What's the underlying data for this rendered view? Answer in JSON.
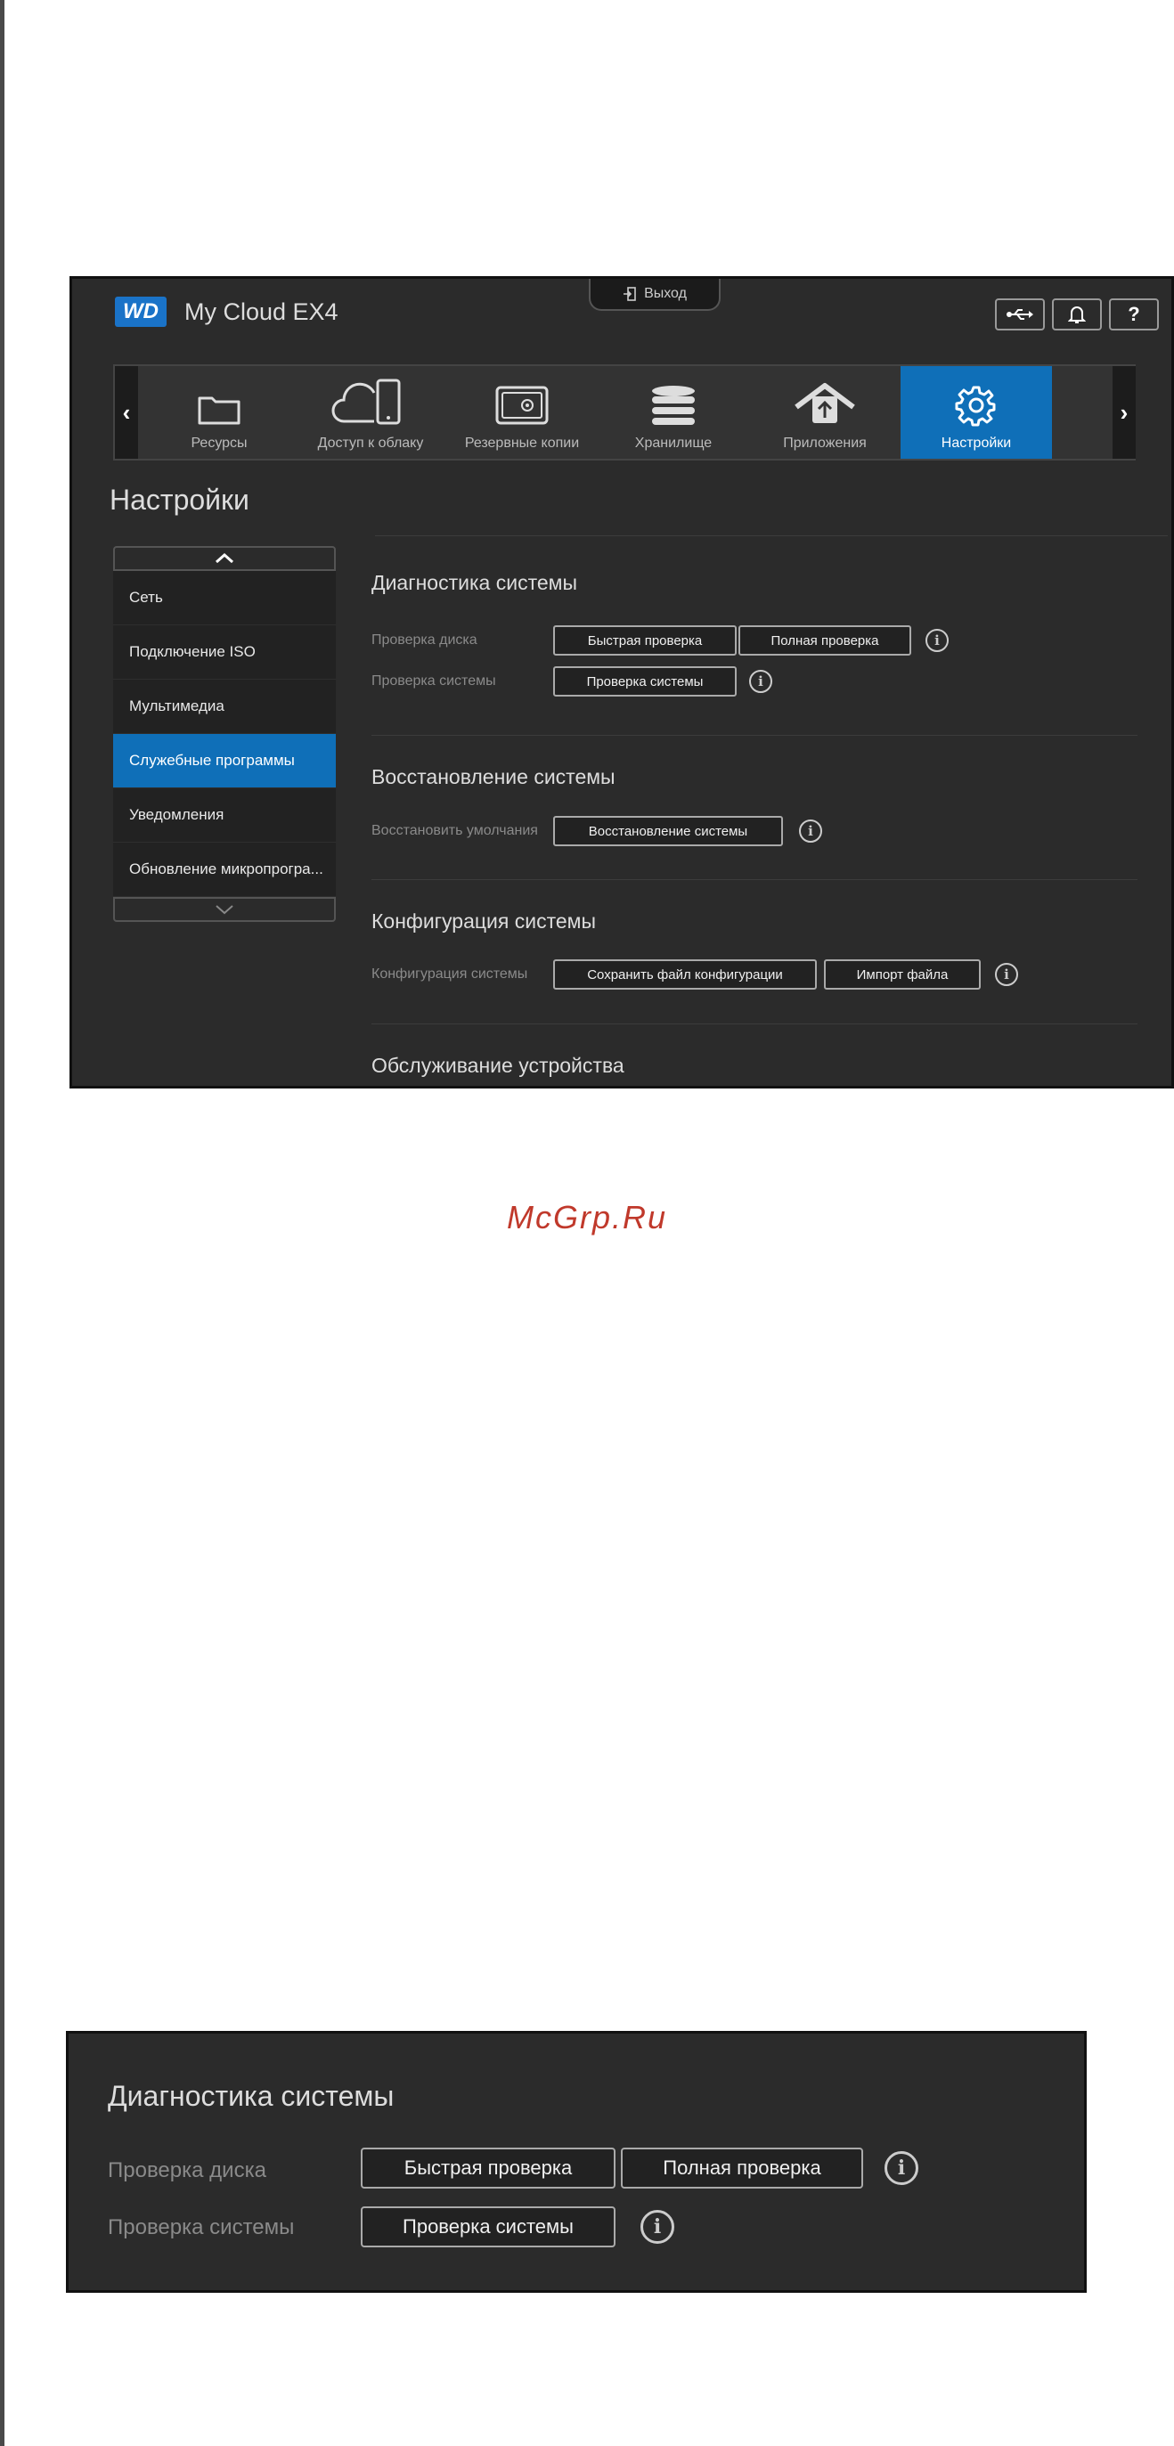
{
  "app": {
    "brand": "WD",
    "product": "My Cloud EX4",
    "logout_label": "Выход",
    "usb_icon": "usb-icon",
    "bell_icon": "bell-icon",
    "help_label": "?"
  },
  "nav": {
    "prev": "‹",
    "next": "›",
    "items": [
      {
        "label": "Ресурсы",
        "icon": "folder-icon"
      },
      {
        "label": "Доступ к облаку",
        "icon": "cloud-device-icon"
      },
      {
        "label": "Резервные копии",
        "icon": "safe-icon"
      },
      {
        "label": "Хранилище",
        "icon": "database-icon"
      },
      {
        "label": "Приложения",
        "icon": "apps-icon"
      },
      {
        "label": "Настройки",
        "icon": "gear-icon",
        "active": true
      }
    ]
  },
  "page": {
    "title": "Настройки"
  },
  "sidebar": {
    "up": "⌃",
    "down": "⌄",
    "items": [
      {
        "label": "Сеть"
      },
      {
        "label": "Подключение ISO"
      },
      {
        "label": "Мультимедиа"
      },
      {
        "label": "Служебные программы",
        "active": true
      },
      {
        "label": "Уведомления"
      },
      {
        "label": "Обновление микропрогра..."
      }
    ]
  },
  "diagnostics": {
    "title": "Диагностика системы",
    "disk_check_label": "Проверка диска",
    "quick_check": "Быстрая проверка",
    "full_check": "Полная проверка",
    "system_check_label": "Проверка системы",
    "system_check": "Проверка системы"
  },
  "restore": {
    "title": "Восстановление системы",
    "restore_defaults_label": "Восстановить умолчания",
    "restore_button": "Восстановление системы"
  },
  "config": {
    "title": "Конфигурация системы",
    "config_label": "Конфигурация системы",
    "save_config": "Сохранить файл конфигурации",
    "import_file": "Импорт файла"
  },
  "maintenance": {
    "title": "Обслуживание устройства"
  },
  "info_glyph": "i",
  "watermark": "McGrp.Ru",
  "colors": {
    "accent": "#0f6fb8",
    "panel": "#2b2b2b",
    "watermark": "#c0392b"
  }
}
